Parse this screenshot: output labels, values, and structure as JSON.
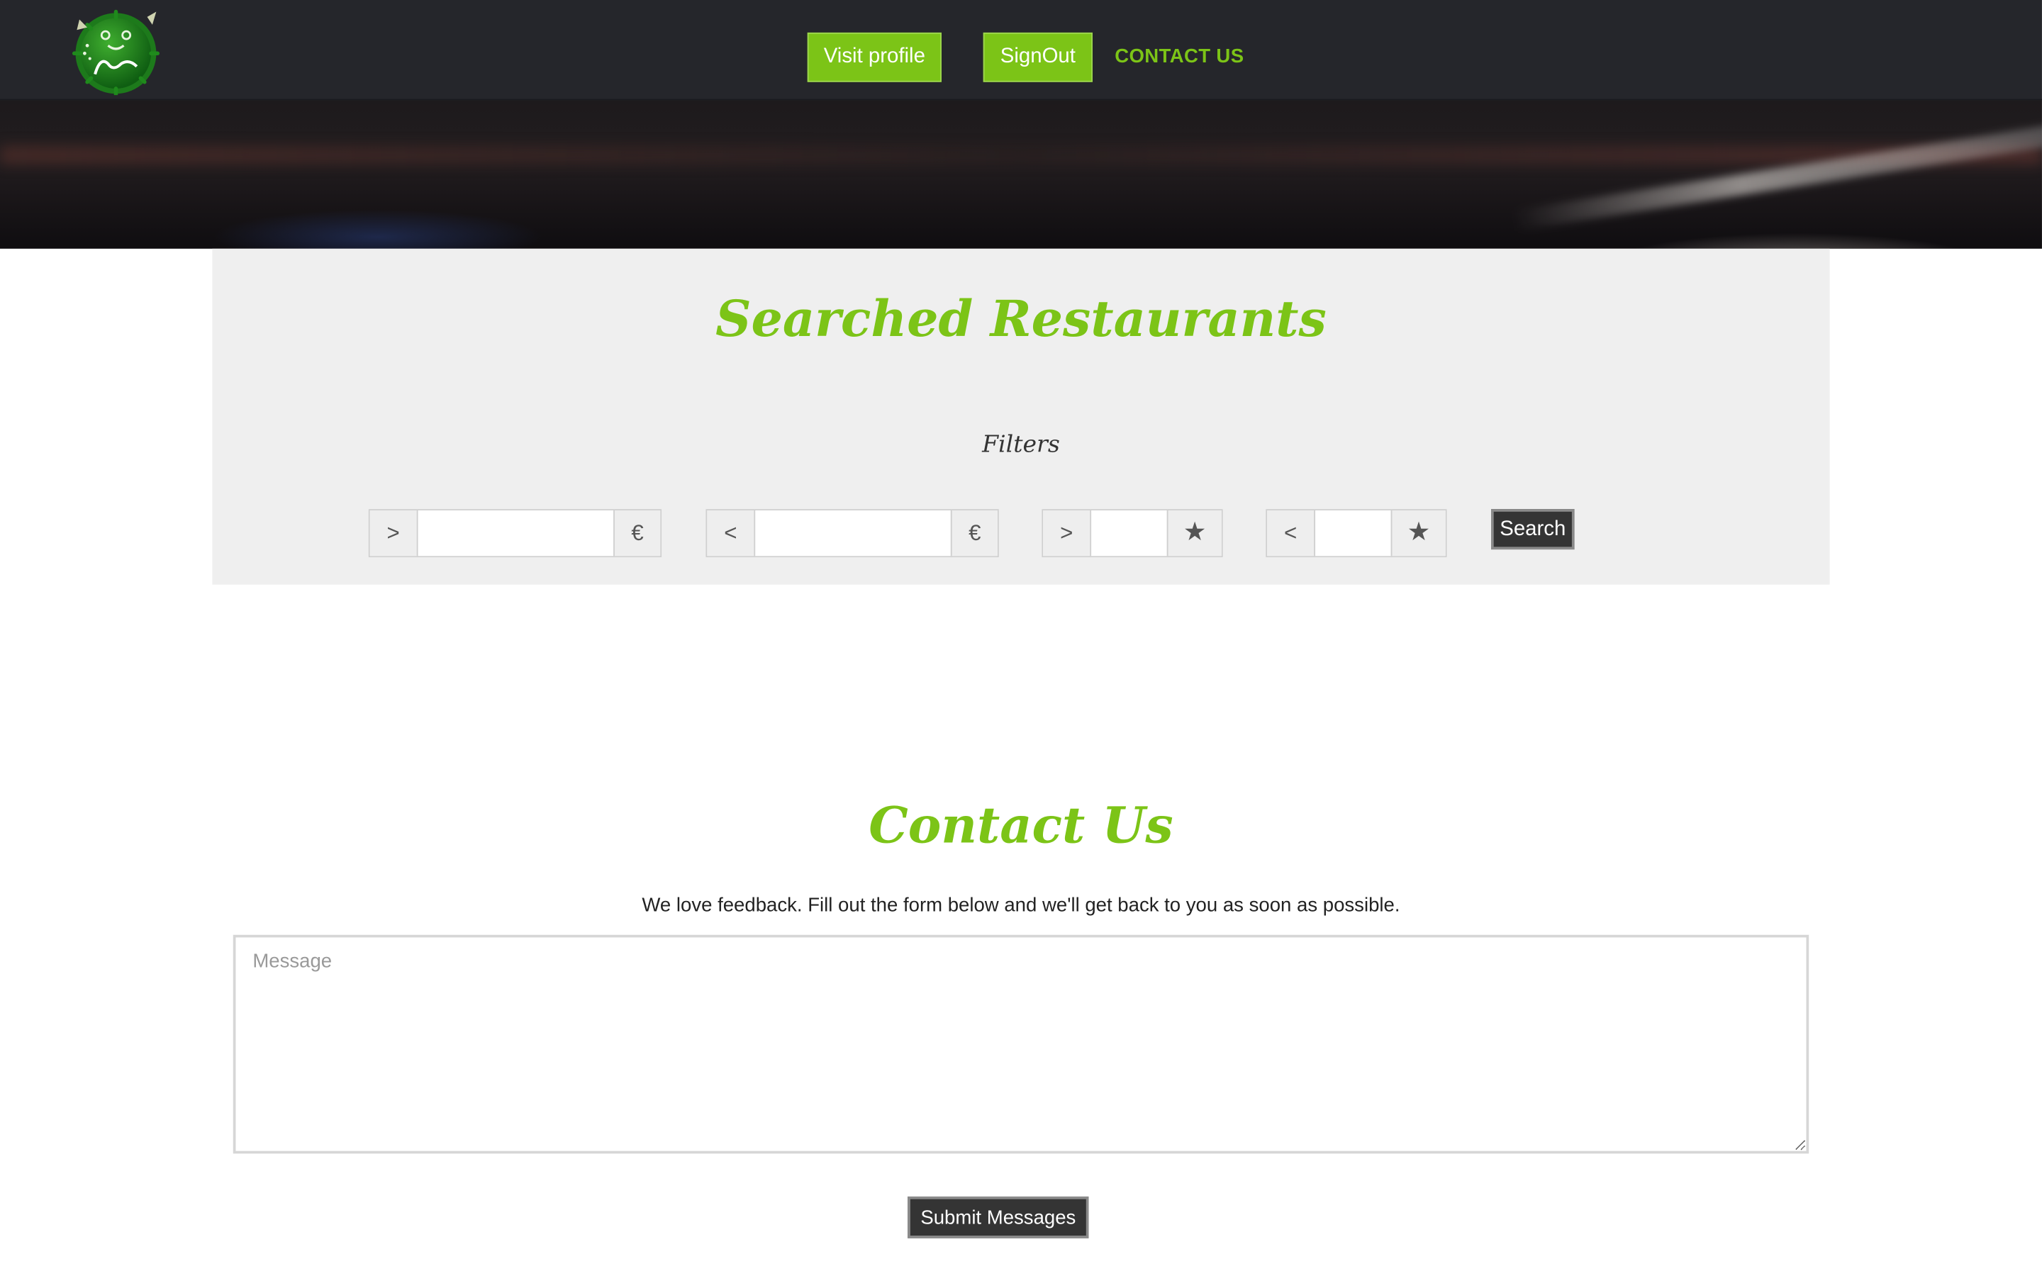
{
  "navbar": {
    "logo_icon": "pufferfish-logo-icon",
    "visit_profile_label": "Visit profile",
    "signout_label": "SignOut",
    "contact_link_label": "CONTACT US"
  },
  "search": {
    "title": "Searched Restaurants",
    "filters_label": "Filters",
    "filters": [
      {
        "prefix": ">",
        "suffix": "€",
        "value": ""
      },
      {
        "prefix": "<",
        "suffix": "€",
        "value": ""
      },
      {
        "prefix": ">",
        "suffix": "★",
        "value": ""
      },
      {
        "prefix": "<",
        "suffix": "★",
        "value": ""
      }
    ],
    "search_button_label": "Search"
  },
  "contact": {
    "title": "Contact Us",
    "description": "We love feedback. Fill out the form below and we'll get back to you as soon as possible.",
    "message_placeholder": "Message",
    "message_value": "",
    "submit_label": "Submit Messages"
  },
  "colors": {
    "accent": "#7cc417",
    "navbar_bg": "#25262b",
    "panel_bg": "#efefef",
    "dark_button": "#343434"
  }
}
